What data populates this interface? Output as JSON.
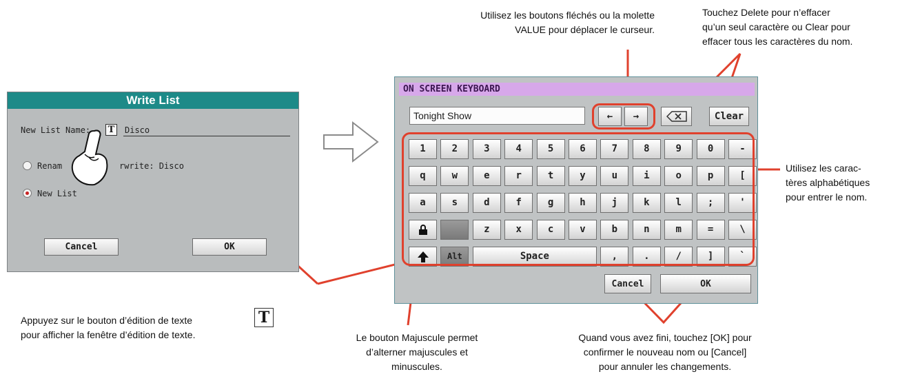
{
  "write_list": {
    "title": "Write List",
    "name_label": "New List Name:",
    "name_value": "Disco",
    "text_edit_icon": "T",
    "option_rename_visible": "Renam",
    "option_rename_tail": "rwrite: Disco",
    "option_new": "New List",
    "selected_option": "New List",
    "cancel": "Cancel",
    "ok": "OK"
  },
  "keyboard": {
    "title": "ON SCREEN KEYBOARD",
    "field_value": "Tonight Show",
    "arrow_left": "←",
    "arrow_right": "→",
    "delete_icon": "delete-icon",
    "clear": "Clear",
    "rows": [
      [
        "1",
        "2",
        "3",
        "4",
        "5",
        "6",
        "7",
        "8",
        "9",
        "0",
        "-"
      ],
      [
        "q",
        "w",
        "e",
        "r",
        "t",
        "y",
        "u",
        "i",
        "o",
        "p",
        "["
      ],
      [
        "a",
        "s",
        "d",
        "f",
        "g",
        "h",
        "j",
        "k",
        "l",
        ";",
        "'"
      ],
      [
        "z",
        "x",
        "c",
        "v",
        "b",
        "n",
        "m",
        "=",
        "\\"
      ],
      [
        ",",
        ".",
        "/",
        "]",
        "`"
      ]
    ],
    "lock_icon": "lock-icon",
    "shift_icon": "shift-up-arrow-icon",
    "alt": "Alt",
    "space": "Space",
    "cancel": "Cancel",
    "ok": "OK"
  },
  "annotations": {
    "arrows_note": [
      "Utilisez les boutons fléchés ou la molette",
      "VALUE pour déplacer le curseur."
    ],
    "delete_note": [
      "Touchez Delete pour n’effacer",
      "qu’un seul caractère ou Clear pour",
      "effacer tous les caractères du nom."
    ],
    "keys_note": [
      "Utilisez les carac-",
      "tères alphabétiques",
      "pour entrer le nom."
    ],
    "edit_note": [
      "Appuyez sur le bouton d’édition de texte",
      "pour afficher la fenêtre d’édition de texte."
    ],
    "shift_note": [
      "Le bouton Majuscule permet",
      "d’alterner majuscules et",
      "minuscules."
    ],
    "ok_note": [
      "Quand vous avez fini, touchez [OK] pour",
      "confirmer le nouveau nom ou [Cancel]",
      "pour annuler les changements."
    ]
  },
  "colors": {
    "accent_red": "#e0412d",
    "dialog_title": "#1d8a88",
    "keyboard_title": "#d7a8ea"
  }
}
